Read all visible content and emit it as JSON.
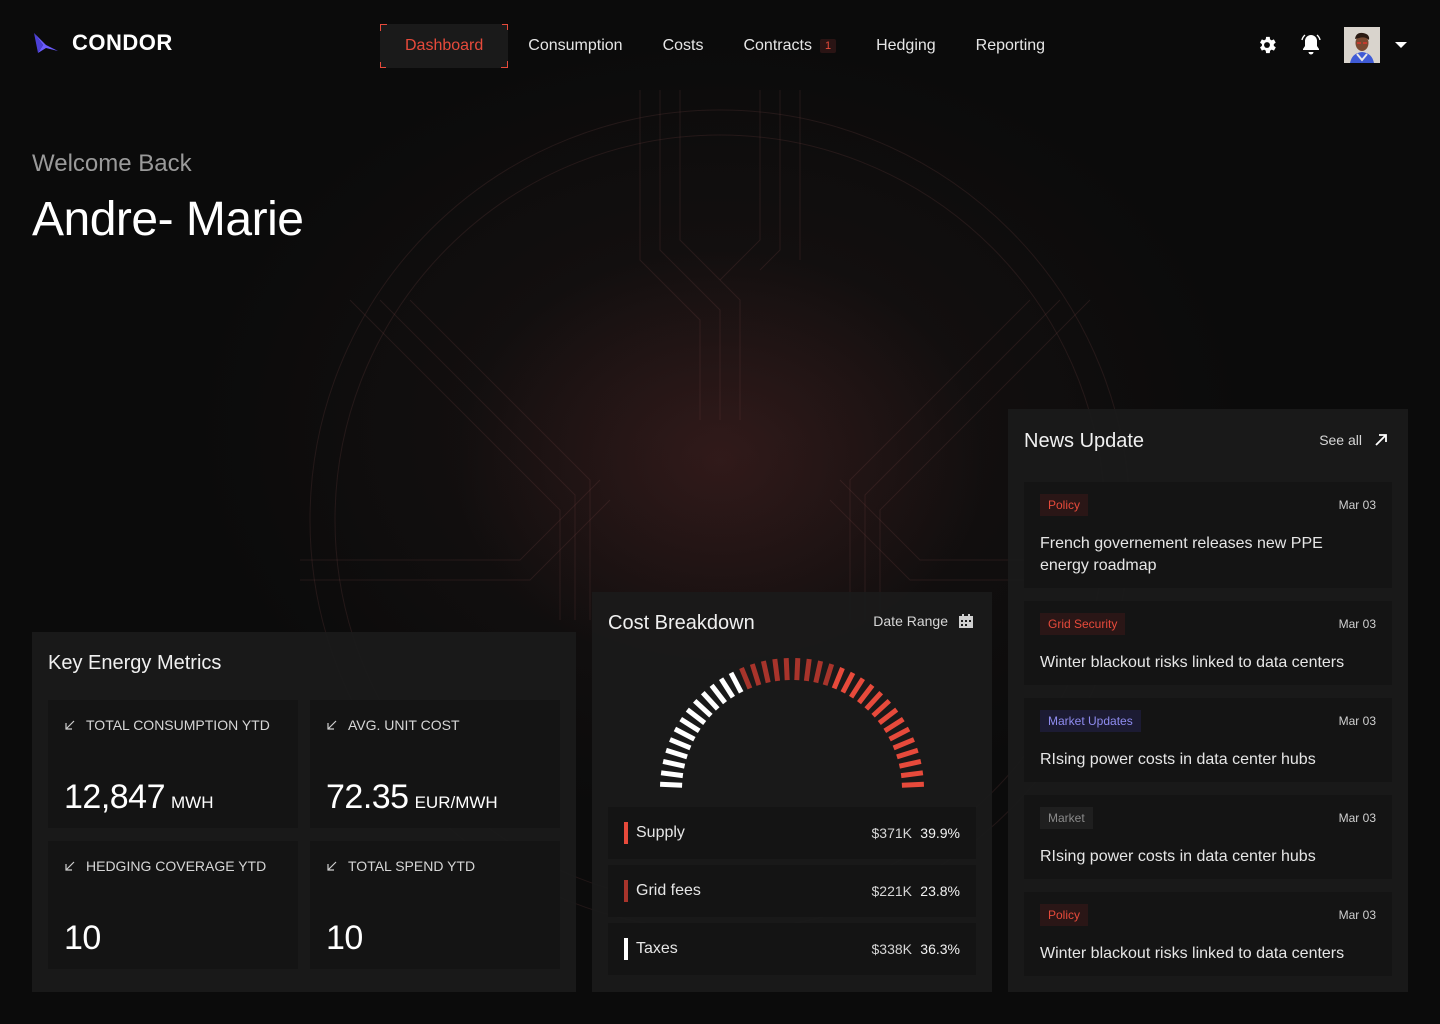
{
  "app": {
    "name": "CONDOR"
  },
  "nav": {
    "items": [
      {
        "label": "Dashboard",
        "active": true
      },
      {
        "label": "Consumption"
      },
      {
        "label": "Costs"
      },
      {
        "label": "Contracts",
        "badge": "1"
      },
      {
        "label": "Hedging"
      },
      {
        "label": "Reporting"
      }
    ],
    "icons": [
      "gear-icon",
      "bell-icon",
      "avatar",
      "chevron-down-icon"
    ]
  },
  "welcome": {
    "greeting": "Welcome Back",
    "name": "Andre- Marie"
  },
  "metrics": {
    "title": "Key Energy Metrics",
    "items": [
      {
        "label": "TOTAL CONSUMPTION YTD",
        "value": "12,847",
        "unit": "MWH"
      },
      {
        "label": "AVG. UNIT COST",
        "value": "72.35",
        "unit": "EUR/MWH"
      },
      {
        "label": "HEDGING COVERAGE YTD",
        "value": "10",
        "unit": ""
      },
      {
        "label": "TOTAL SPEND YTD",
        "value": "10",
        "unit": ""
      }
    ]
  },
  "cost": {
    "title": "Cost Breakdown",
    "date_range": "Date Range",
    "rows": [
      {
        "label": "Supply",
        "amount": "$371K",
        "pct": "39.9%",
        "color": "#e74a3b"
      },
      {
        "label": "Grid fees",
        "amount": "$221K",
        "pct": "23.8%",
        "color": "#a8342b"
      },
      {
        "label": "Taxes",
        "amount": "$338K",
        "pct": "36.3%",
        "color": "#ffffff"
      }
    ],
    "gauge": {
      "fraction_white": 0.363,
      "fraction_dark_red": 0.238,
      "fraction_red": 0.399
    }
  },
  "news": {
    "title": "News Update",
    "see_all": "See all",
    "items": [
      {
        "tag": "Policy",
        "tag_color": "#e74a3b",
        "tag_bg": "#2a1616",
        "date": "Mar 03",
        "text": "French governement releases new PPE energy roadmap"
      },
      {
        "tag": "Grid Security",
        "tag_color": "#e74a3b",
        "tag_bg": "#2a1616",
        "date": "Mar 03",
        "text": "Winter blackout risks linked to data centers"
      },
      {
        "tag": "Market Updates",
        "tag_color": "#8f8cf0",
        "tag_bg": "#1c1b33",
        "date": "Mar 03",
        "text": "RIsing power costs in data center hubs"
      },
      {
        "tag": "Market",
        "tag_color": "#8a8a8a",
        "tag_bg": "#1f1f1f",
        "date": "Mar 03",
        "text": "RIsing power costs in data center hubs"
      },
      {
        "tag": "Policy",
        "tag_color": "#e74a3b",
        "tag_bg": "#2a1616",
        "date": "Mar 03",
        "text": "Winter blackout risks linked to data centers"
      }
    ]
  },
  "colors": {
    "accent": "#e74a3b",
    "background": "#0b0b0b",
    "card": "#1a1a1a"
  }
}
